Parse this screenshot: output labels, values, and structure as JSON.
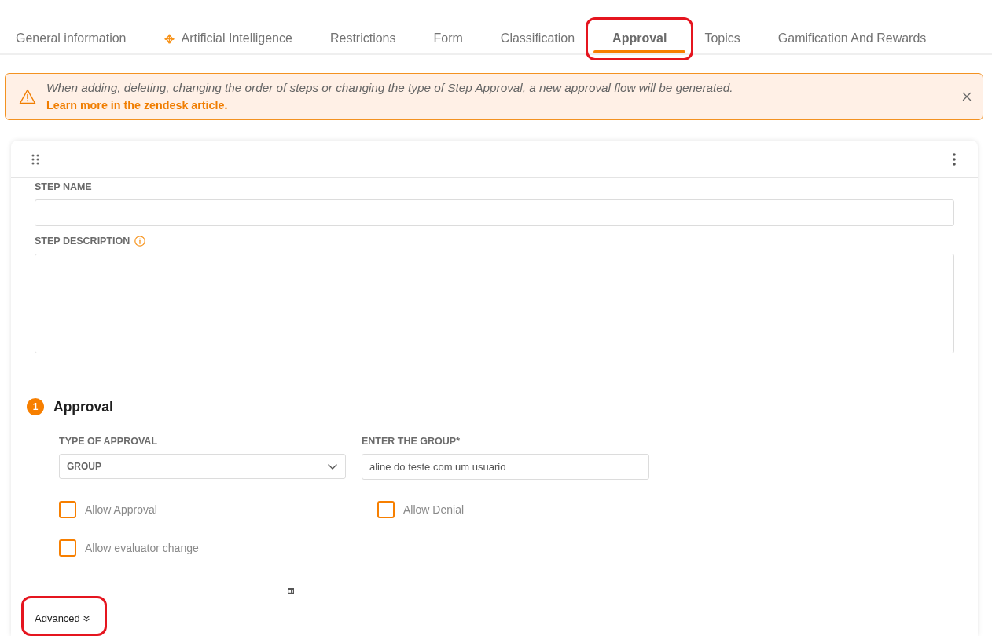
{
  "tabs": [
    {
      "label": "General information",
      "kind": "text",
      "selected": false,
      "highlighted": false
    },
    {
      "label": "Artificial Intelligence",
      "kind": "icon_text",
      "selected": false,
      "highlighted": false
    },
    {
      "label": "Restrictions",
      "kind": "text",
      "selected": false,
      "highlighted": false
    },
    {
      "label": "Form",
      "kind": "text",
      "selected": false,
      "highlighted": false
    },
    {
      "label": "Classification",
      "kind": "text",
      "selected": false,
      "highlighted": false
    },
    {
      "label": "Approval",
      "kind": "text",
      "selected": true,
      "highlighted": true
    },
    {
      "label": "Topics",
      "kind": "text",
      "selected": false,
      "highlighted": false
    },
    {
      "label": "Gamification And Rewards",
      "kind": "text",
      "selected": false,
      "highlighted": false
    }
  ],
  "alert": {
    "message": "When adding, deleting, changing the order of steps or changing the type of Step Approval, a new approval flow will be generated.",
    "link": "Learn more in the zendesk article."
  },
  "step": {
    "fields": [
      {
        "label": "STEP NAME",
        "kind": "input",
        "info": false
      },
      {
        "label": "STEP DESCRIPTION",
        "kind": "textarea",
        "info": true
      }
    ],
    "approval": {
      "number": "1",
      "title": "Approval",
      "fields": [
        {
          "label": "TYPE OF APPROVAL",
          "kind": "select",
          "value": "GROUP"
        },
        {
          "label": "ENTER THE GROUP*",
          "kind": "input",
          "value": "aline do teste com um usuario"
        }
      ],
      "checkboxes": [
        {
          "label": "Allow Approval",
          "checked": false
        },
        {
          "label": "Allow Denial",
          "checked": false
        },
        {
          "label": "Allow evaluator change",
          "checked": false
        }
      ]
    },
    "advanced": {
      "label": "Advanced",
      "highlighted": true
    }
  }
}
